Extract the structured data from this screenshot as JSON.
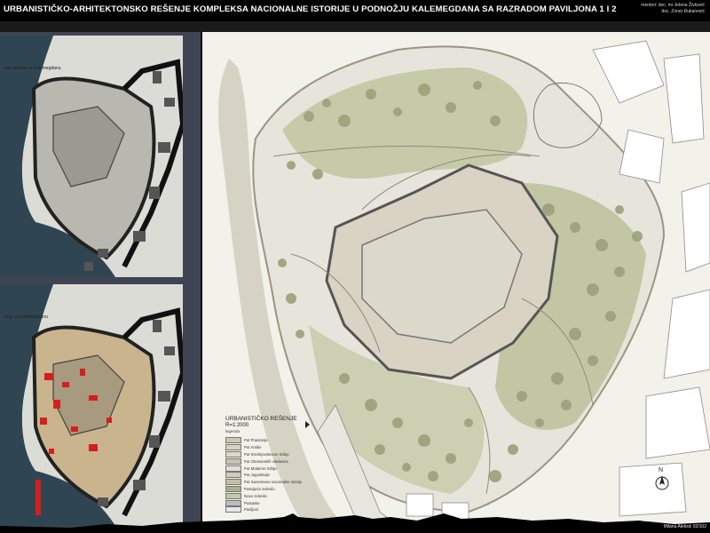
{
  "title": "URBANISTIČKO-ARHITEKTONSKO REŠENJE KOMPLEKSA NACIONALNE ISTORIJE U PODNOŽJU KALEMEGDANA SA RAZRADOM PAVILJONA 1 I 2",
  "mentors": {
    "line1": "mentori: doc. mr Jelena Živković",
    "line2": "doc. Zoran Đukanović"
  },
  "small_maps": [
    {
      "label": "odje istorije na Kalemegdanu"
    },
    {
      "label": "onije na Kalemegdanu"
    }
  ],
  "legend": {
    "title": "URBANISTIČKO REŠENJE",
    "scale": "R=1:2000",
    "subtitle": "legenda",
    "items": [
      {
        "label": "Put Praistorije",
        "color": "#cfc7b3"
      },
      {
        "label": "Put Antike",
        "color": "#d8d2c0"
      },
      {
        "label": "Put Srednjovekovne Srbije",
        "color": "#ddd8c8"
      },
      {
        "label": "Put Otomanskih vladavine",
        "color": "#c9c2ae"
      },
      {
        "label": "Put Moderne Srbije",
        "color": "#e3ded0"
      },
      {
        "label": "Put Jugoslavije",
        "color": "#d2cbb8"
      },
      {
        "label": "Put Savremene nacionalne istorije",
        "color": "#c4bda8"
      },
      {
        "label": "Postojeće zelenilo",
        "color": "#a9b08a"
      },
      {
        "label": "Novo zelenilo",
        "color": "#c2c7a6"
      },
      {
        "label": "Postavke",
        "color": "#bdbdbd"
      },
      {
        "label": "Paviljoni",
        "color": "#e6e6e6"
      }
    ]
  },
  "north_label": "N",
  "candidates": {
    "line1": "kandidati: Anđelka Borović 02/14",
    "line2": "Milana Aleksić 02/102"
  },
  "colors": {
    "park_green": "#a9b08a",
    "plaza_beige": "#d9d3c1",
    "highlight_red": "#d41f1f",
    "water": "#2f4652"
  }
}
